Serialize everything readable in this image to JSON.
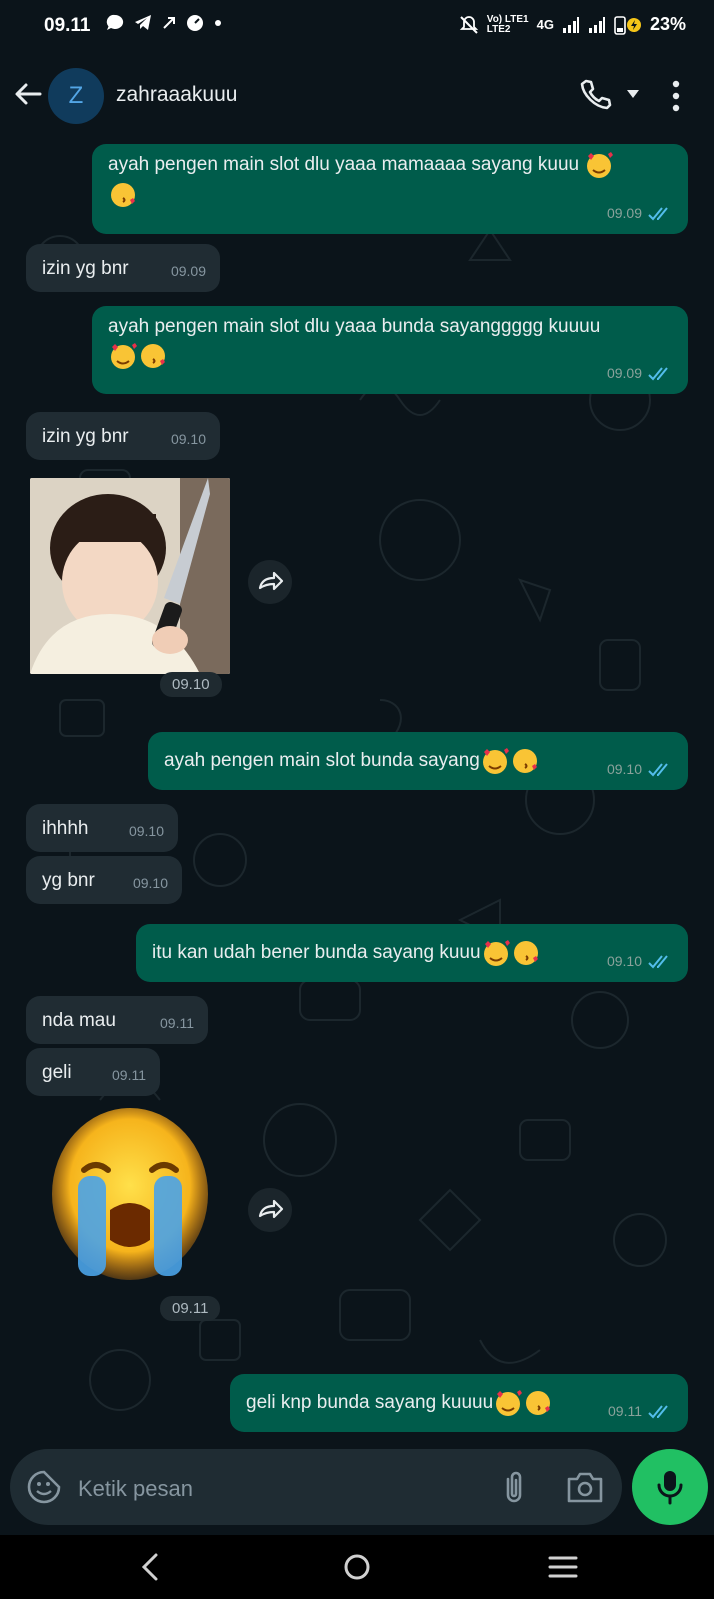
{
  "status_bar": {
    "time": "09.11",
    "network_top": "Vo) LTE1",
    "network_bottom": "LTE2",
    "network_type": "4G",
    "battery": "23%"
  },
  "header": {
    "avatar_letter": "Z",
    "contact_name": "zahraaakuuu"
  },
  "messages": [
    {
      "dir": "out",
      "text": "ayah pengen main slot dlu yaaa mamaaaa sayang kuuu",
      "emojis": [
        "smiling-face-with-hearts",
        "face-blowing-kiss"
      ],
      "time": "09.09"
    },
    {
      "dir": "in",
      "text": "izin yg bnr",
      "time": "09.09"
    },
    {
      "dir": "out",
      "text": "ayah pengen main slot dlu yaaa bunda sayanggggg kuuuu",
      "emojis": [
        "smiling-face-with-hearts",
        "face-blowing-kiss"
      ],
      "time": "09.09"
    },
    {
      "dir": "in",
      "text": "izin yg bnr",
      "time": "09.10"
    },
    {
      "dir": "in",
      "type": "sticker",
      "sticker": "child-holding-knife",
      "time": "09.10"
    },
    {
      "dir": "out",
      "text": "ayah pengen main slot bunda sayang",
      "emojis": [
        "smiling-face-with-hearts",
        "face-blowing-kiss"
      ],
      "time": "09.10"
    },
    {
      "dir": "in",
      "text": "ihhhh",
      "time": "09.10"
    },
    {
      "dir": "in",
      "text": "yg bnr",
      "time": "09.10"
    },
    {
      "dir": "out",
      "text": "itu kan udah bener bunda sayang kuuu",
      "emojis": [
        "smiling-face-with-hearts",
        "face-blowing-kiss"
      ],
      "time": "09.10"
    },
    {
      "dir": "in",
      "text": "nda mau",
      "time": "09.11"
    },
    {
      "dir": "in",
      "text": "geli",
      "time": "09.11"
    },
    {
      "dir": "in",
      "type": "sticker",
      "sticker": "loudly-crying-face",
      "time": "09.11"
    },
    {
      "dir": "out",
      "text": "geli knp bunda sayang kuuuu",
      "emojis": [
        "smiling-face-with-hearts",
        "face-blowing-kiss"
      ],
      "time": "09.11"
    }
  ],
  "composer": {
    "placeholder": "Ketik pesan"
  },
  "colors": {
    "background": "#0b141a",
    "outgoing_bubble": "#005c4b",
    "incoming_bubble": "#202c33",
    "accent": "#21c063",
    "read_tick": "#53bdeb"
  }
}
